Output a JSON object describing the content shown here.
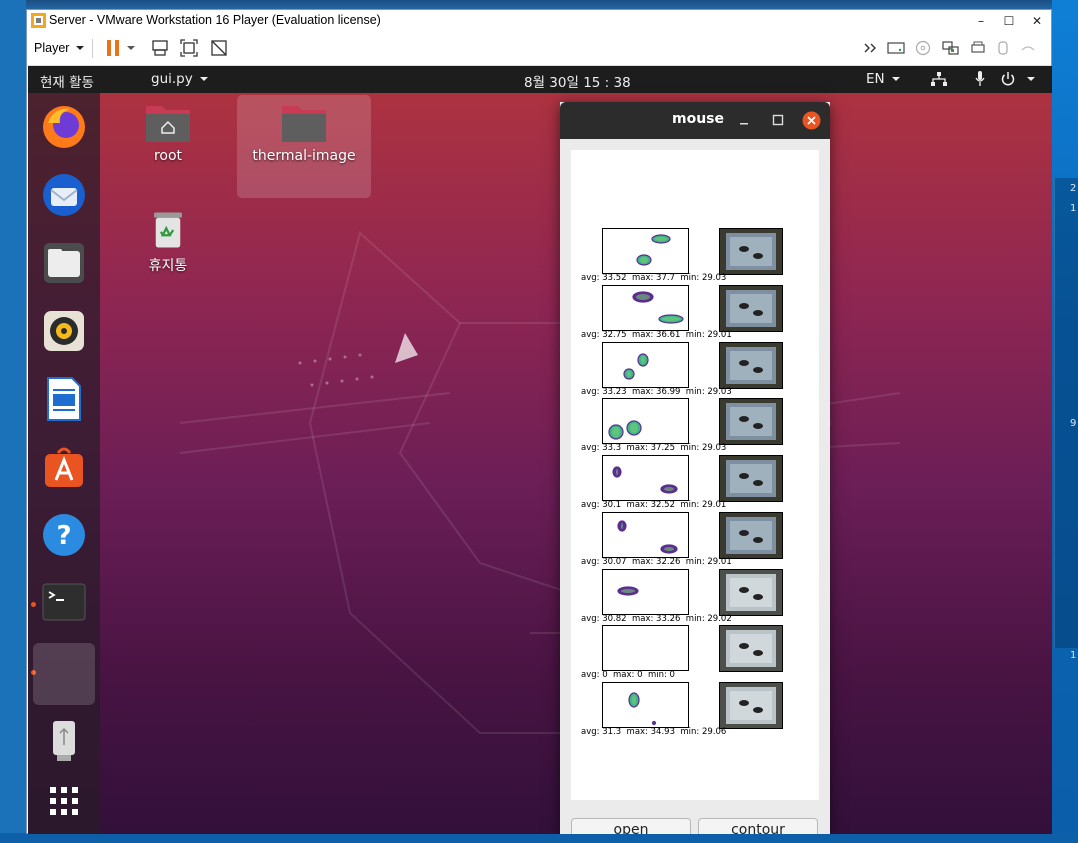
{
  "host": {
    "right_numbers": [
      "2",
      "1",
      "9",
      "1"
    ]
  },
  "vmware": {
    "title": "Server - VMware Workstation 16 Player (Evaluation license)",
    "player_label": "Player",
    "window_buttons": [
      "–",
      "☐",
      "✕"
    ]
  },
  "gnome": {
    "activities": "현재 활동",
    "app_menu": "gui.py",
    "clock": "8월 30일  15 : 38",
    "language": "EN"
  },
  "desktop": {
    "icons": [
      {
        "label": "root"
      },
      {
        "label": "thermal-image"
      },
      {
        "label": "휴지통"
      }
    ]
  },
  "mouse_window": {
    "title": "mouse",
    "open_label": "open",
    "contour_label": "contour",
    "rows": [
      {
        "avg": "33.52",
        "max": "37.7",
        "min": "29.03"
      },
      {
        "avg": "32.75",
        "max": "36.61",
        "min": "29.01"
      },
      {
        "avg": "33.23",
        "max": "36.99",
        "min": "29.03"
      },
      {
        "avg": "33.3",
        "max": "37.25",
        "min": "29.03"
      },
      {
        "avg": "30.1",
        "max": "32.52",
        "min": "29.01"
      },
      {
        "avg": "30.07",
        "max": "32.26",
        "min": "29.01"
      },
      {
        "avg": "30.82",
        "max": "33.26",
        "min": "29.02"
      },
      {
        "avg": "0",
        "max": "0",
        "min": "0"
      },
      {
        "avg": "31.3",
        "max": "34.93",
        "min": "29.06"
      }
    ]
  },
  "colors": {
    "ubuntu_orange": "#e95420",
    "thermal_green": "#3fb58a",
    "thermal_purple": "#5a2f8f"
  }
}
